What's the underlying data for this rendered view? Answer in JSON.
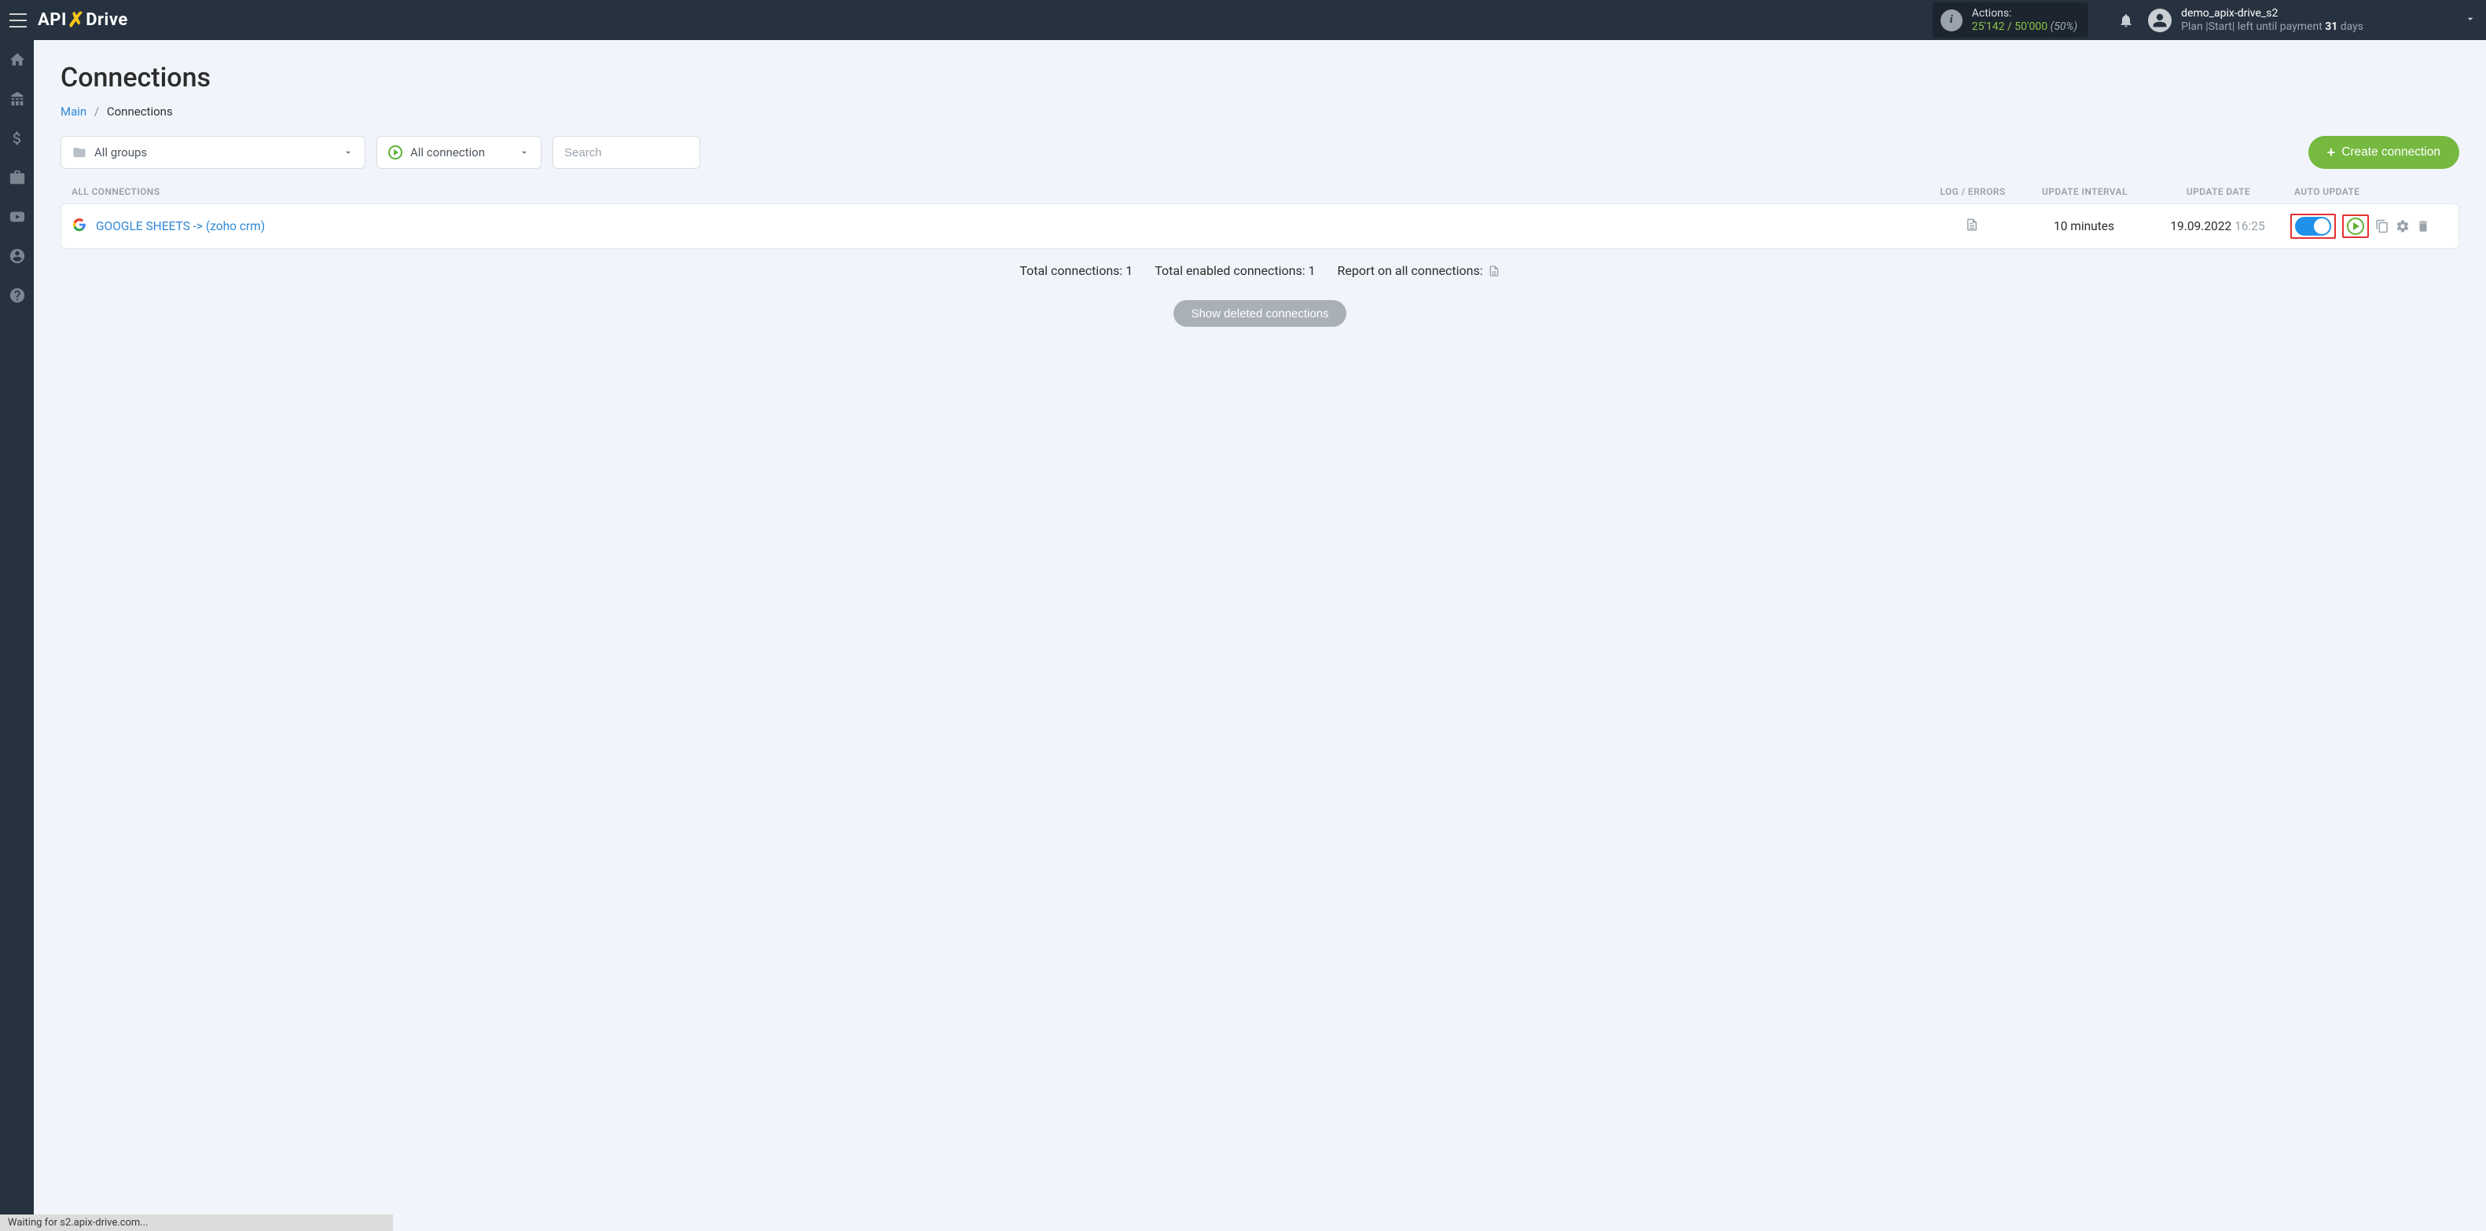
{
  "header": {
    "actions_label": "Actions:",
    "actions_used": "25'142",
    "actions_limit": "/ 50'000",
    "actions_pct": "(50%)",
    "user_name": "demo_apix-drive_s2",
    "plan_prefix": "Plan |",
    "plan_name": "Start",
    "plan_text": "|  left until payment ",
    "plan_days": "31",
    "plan_days_suffix": " days"
  },
  "page": {
    "title": "Connections",
    "breadcrumb_main": "Main",
    "breadcrumb_current": "Connections"
  },
  "filters": {
    "groups_label": "All groups",
    "conn_label": "All connection",
    "search_placeholder": "Search",
    "create_label": "Create connection"
  },
  "table": {
    "headers": {
      "all": "ALL CONNECTIONS",
      "log": "LOG / ERRORS",
      "interval": "UPDATE INTERVAL",
      "date": "UPDATE DATE",
      "auto": "AUTO UPDATE"
    },
    "rows": [
      {
        "name": "GOOGLE SHEETS -> (zoho crm)",
        "interval": "10 minutes",
        "date": "19.09.2022",
        "time": "16:25"
      }
    ]
  },
  "summary": {
    "total": "Total connections: 1",
    "enabled": "Total enabled connections: 1",
    "report": "Report on all connections:"
  },
  "deleted_btn": "Show deleted connections",
  "status_bar": "Waiting for s2.apix-drive.com..."
}
